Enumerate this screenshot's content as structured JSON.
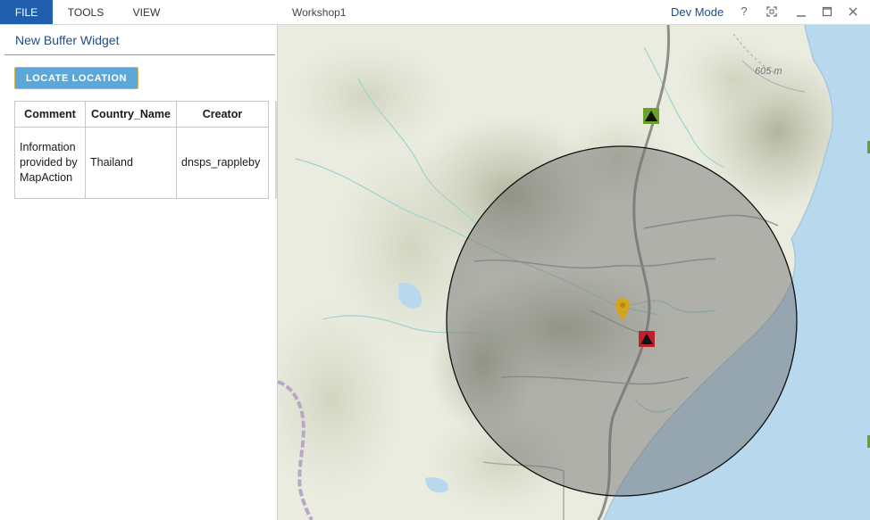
{
  "menu": {
    "file": "FILE",
    "tools": "TOOLS",
    "view": "VIEW"
  },
  "app_title": "Workshop1",
  "window": {
    "dev_mode": "Dev Mode",
    "help": "?",
    "fit": "⛶",
    "minimize": "–",
    "maximize": "☐",
    "close": "✕"
  },
  "widget": {
    "title": "New Buffer Widget",
    "locate_button": "LOCATE LOCATION",
    "table": {
      "headers": [
        "Comment",
        "Country_Name",
        "Creator"
      ],
      "rows": [
        [
          "Information provided by MapAction",
          "Thailand",
          "dnsps_rappleby"
        ]
      ]
    }
  },
  "map": {
    "elevation_label": "605 m",
    "colors": {
      "land": "#e9ecdf",
      "sea": "#b8d8ed",
      "buffer_fill": "#6f6f6f",
      "marker_pin": "#d4a51c",
      "marker_red": "#c0202a",
      "marker_green": "#6aa12a"
    },
    "icons": [
      "pin-marker-icon",
      "triangle-red-marker-icon",
      "triangle-green-marker-icon"
    ]
  }
}
